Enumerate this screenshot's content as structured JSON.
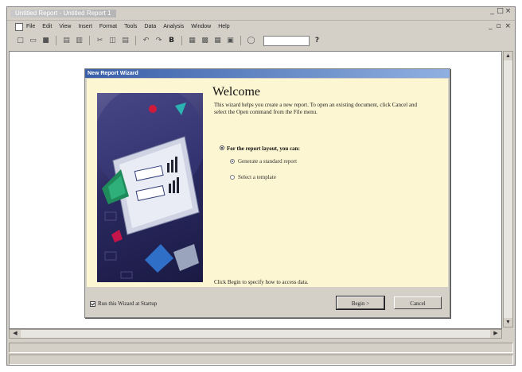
{
  "app": {
    "title": "Untitled Report - Untitled Report 1",
    "window_controls": [
      "_",
      "□",
      "×"
    ],
    "menu": [
      "File",
      "Edit",
      "View",
      "Insert",
      "Format",
      "Tools",
      "Data",
      "Analysis",
      "Window",
      "Help"
    ],
    "mdi_controls": "_ ▫ ×"
  },
  "toolbar": {
    "buttons": [
      "new-icon",
      "open-icon",
      "save-icon",
      "print-icon",
      "preview-icon",
      "cut-icon",
      "copy-icon",
      "paste-icon",
      "undo-icon",
      "redo-icon",
      "bold-icon",
      "field-icon",
      "chart-icon",
      "table-icon",
      "picture-icon",
      "zoom-icon",
      "help-icon"
    ]
  },
  "dialog": {
    "title": "New Report Wizard",
    "heading": "Welcome",
    "intro": "This wizard helps you create a new report. To open an existing document, click Cancel and select the Open command from the File menu.",
    "layout_heading": "For the report layout, you can:",
    "options": [
      "Generate a standard report",
      "Select a template"
    ],
    "selected_option": 0,
    "begin_hint": "Click Begin to specify how to access data.",
    "startup_label": "Run this Wizard at Startup",
    "startup_checked": true,
    "begin_button": "Begin >",
    "cancel_button": "Cancel"
  },
  "colors": {
    "dialog_body": "#fdf6d2",
    "title_bar": "#3a5fa8",
    "chrome": "#d4d0c8"
  }
}
